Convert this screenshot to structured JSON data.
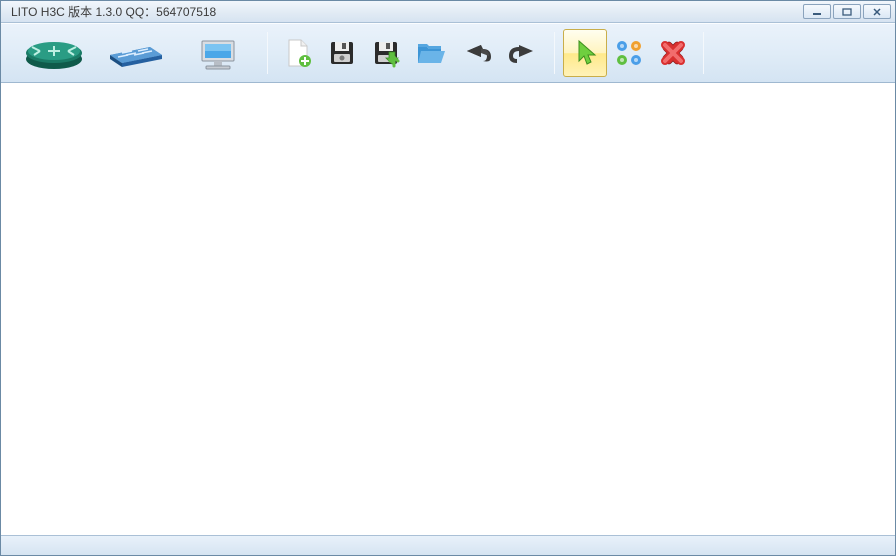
{
  "window": {
    "title": "LITO H3C 版本 1.3.0 QQ：564707518"
  },
  "toolbar": {
    "devices": {
      "router": "router",
      "switch": "switch",
      "pc": "pc"
    },
    "file": {
      "new": "new",
      "save": "save",
      "export": "export",
      "open": "open",
      "undo": "undo",
      "redo": "redo"
    },
    "tools": {
      "select": "select",
      "topology": "topology",
      "delete": "delete"
    }
  }
}
